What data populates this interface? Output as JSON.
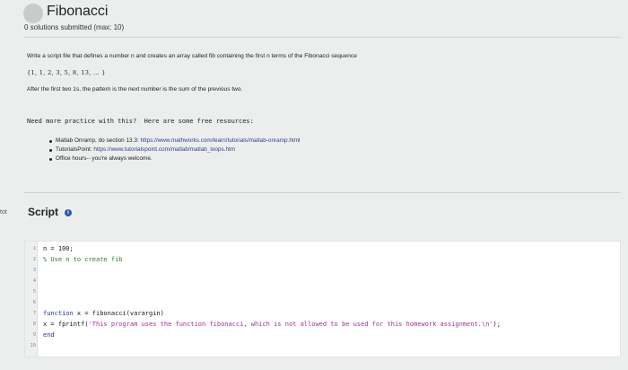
{
  "header": {
    "title": "Fibonacci",
    "subtitle": "0 solutions submitted (max: 10)"
  },
  "description": {
    "line1": "Write a script file that defines a number n and creates an array called fib containing the first n terms of the Fibonacci sequence",
    "sequence": "{1, 1, 2, 3, 5, 8, 13, … }",
    "line3": "After the first two 1s, the pattern is the next number is the sum of the previous two."
  },
  "practice": {
    "heading": "Need more practice with this?  Here are some free resources:",
    "items": [
      {
        "text": "Matlab Onramp, do section 13.3: ",
        "link": "https://www.mathworks.com/learn/tutorials/matlab-onramp.html"
      },
      {
        "text": "TutorialsPoint: ",
        "link": "https://www.tutorialspoint.com/matlab/matlab_loops.htm"
      },
      {
        "text": "Office hours-- you're always welcome.",
        "link": ""
      }
    ]
  },
  "script": {
    "side_label": "tot",
    "title": "Script",
    "info_icon": "info-icon",
    "lines": [
      {
        "n": "1",
        "text": "n = 100;",
        "type": "code"
      },
      {
        "n": "2",
        "text": "% Use n to create fib",
        "type": "comment"
      },
      {
        "n": "3",
        "text": "",
        "type": "code"
      },
      {
        "n": "4",
        "text": "",
        "type": "code"
      },
      {
        "n": "5",
        "text": "",
        "type": "code"
      },
      {
        "n": "6",
        "text": "",
        "type": "code"
      },
      {
        "n": "7",
        "text": "function x = fibonacci(varargin)",
        "type": "function"
      },
      {
        "n": "8",
        "text": "x = fprintf('This program uses the function fibonacci, which is not allowed to be used for this homework assignment.\\n');",
        "type": "printf"
      },
      {
        "n": "9",
        "text": "end",
        "type": "end"
      },
      {
        "n": "10",
        "text": "",
        "type": "code"
      }
    ]
  },
  "colors": {
    "background": "#eceeee",
    "link": "#2a3e88",
    "info_icon": "#2c5ba8",
    "comment": "#2f7a2f",
    "keyword": "#2238a0",
    "string": "#9c2fa0"
  }
}
